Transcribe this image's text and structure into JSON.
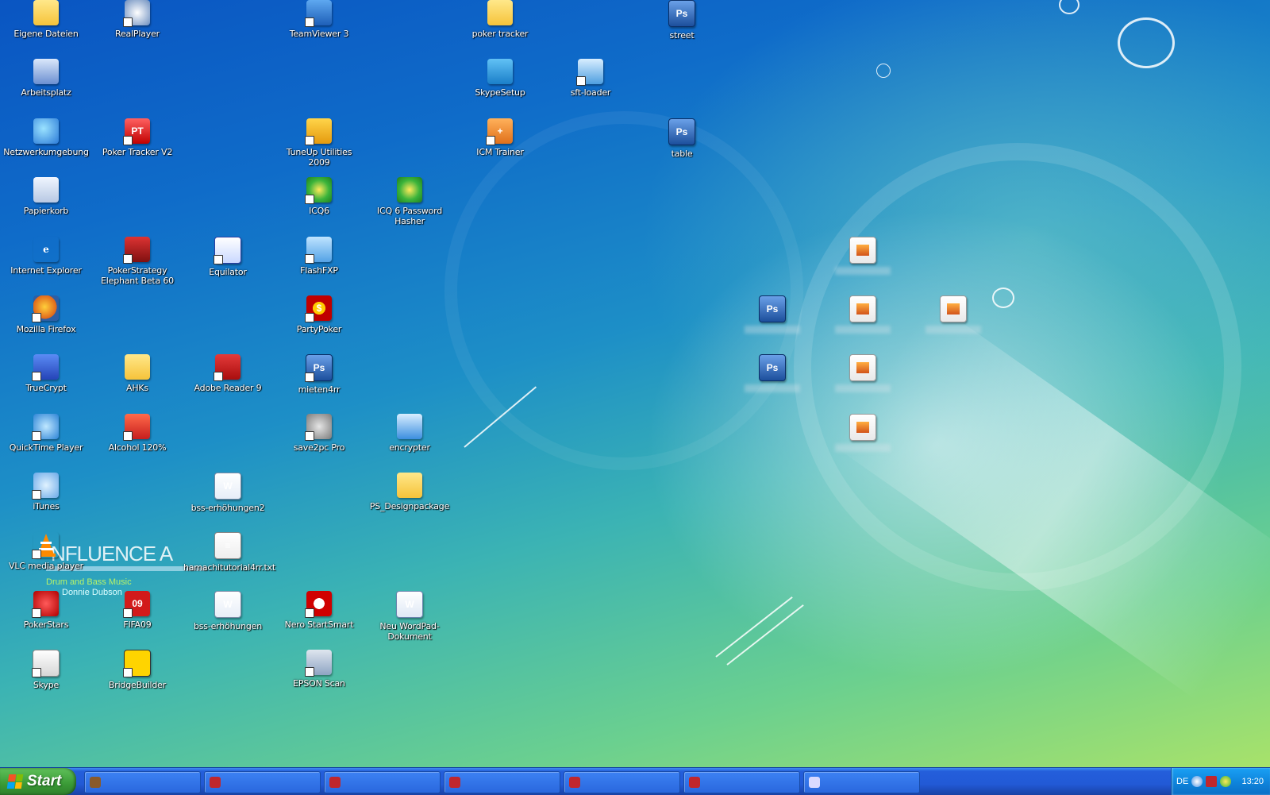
{
  "desktop": {
    "icons": [
      {
        "label": "Eigene Dateien",
        "icon": "folder-icon",
        "style": "g-folder",
        "shortcut": false
      },
      {
        "label": "Arbeitsplatz",
        "icon": "computer-icon",
        "style": "g-pc",
        "shortcut": false
      },
      {
        "label": "Netzwerkumgebung",
        "icon": "network-icon",
        "style": "g-net",
        "shortcut": false
      },
      {
        "label": "Papierkorb",
        "icon": "recycle-bin-icon",
        "style": "g-trash",
        "shortcut": false
      },
      {
        "label": "Internet Explorer",
        "icon": "internet-explorer-icon",
        "style": "g-ie",
        "glyph": "e",
        "shortcut": false
      },
      {
        "label": "Mozilla Firefox",
        "icon": "firefox-icon",
        "style": "g-ff",
        "shortcut": true
      },
      {
        "label": "TrueCrypt",
        "icon": "truecrypt-icon",
        "style": "g-tc",
        "shortcut": true
      },
      {
        "label": "QuickTime Player",
        "icon": "quicktime-icon",
        "style": "g-qt",
        "shortcut": true
      },
      {
        "label": "iTunes",
        "icon": "itunes-icon",
        "style": "g-it",
        "shortcut": true
      },
      {
        "label": "VLC media player",
        "icon": "vlc-cone-icon",
        "style": "g-vlc",
        "shortcut": true
      },
      {
        "label": "PokerStars",
        "icon": "pokerstars-icon",
        "style": "g-ps2",
        "shortcut": true
      },
      {
        "label": "Skype",
        "icon": "skype-icon",
        "style": "g-skype",
        "shortcut": true
      },
      {
        "label": "RealPlayer",
        "icon": "realplayer-icon",
        "style": "g-real",
        "shortcut": true
      },
      {
        "label": "Poker Tracker V2",
        "icon": "poker-tracker-icon",
        "style": "g-pt",
        "glyph": "PT",
        "shortcut": true
      },
      {
        "label": "PokerStrategy Elephant Beta 60",
        "icon": "elephant-icon",
        "style": "g-elephant",
        "shortcut": true
      },
      {
        "label": "AHKs",
        "icon": "folder-icon",
        "style": "g-ahk",
        "shortcut": false
      },
      {
        "label": "Alcohol 120%",
        "icon": "alcohol-icon",
        "style": "g-alc",
        "shortcut": true
      },
      {
        "label": "FIFA09",
        "icon": "fifa-icon",
        "style": "g-fifa",
        "glyph": "09",
        "shortcut": true
      },
      {
        "label": "BridgeBuilder",
        "icon": "bridgebuilder-icon",
        "style": "g-bridge",
        "shortcut": true
      },
      {
        "label": "Equilator",
        "icon": "equilator-icon",
        "style": "g-eq",
        "shortcut": true
      },
      {
        "label": "Adobe Reader 9",
        "icon": "adobe-reader-icon",
        "style": "g-pdf",
        "shortcut": true
      },
      {
        "label": "bss-erhöhungen2",
        "icon": "word-document-icon",
        "style": "g-doc",
        "glyph": "W",
        "shortcut": false
      },
      {
        "label": "hamachitutorial4rr.txt",
        "icon": "text-file-icon",
        "style": "g-txt",
        "glyph": "≡",
        "shortcut": false
      },
      {
        "label": "bss-erhöhungen",
        "icon": "word-document-icon",
        "style": "g-doc",
        "glyph": "W",
        "shortcut": false
      },
      {
        "label": "TeamViewer 3",
        "icon": "teamviewer-icon",
        "style": "g-tv",
        "shortcut": true
      },
      {
        "label": "TuneUp Utilities 2009",
        "icon": "tuneup-icon",
        "style": "g-tune",
        "shortcut": true
      },
      {
        "label": "ICQ6",
        "icon": "icq-flower-icon",
        "style": "g-icq",
        "shortcut": true
      },
      {
        "label": "FlashFXP",
        "icon": "flashfxp-icon",
        "style": "g-ftp",
        "shortcut": true
      },
      {
        "label": "PartyPoker",
        "icon": "partypoker-icon",
        "style": "g-party",
        "glyph": "$",
        "shortcut": true
      },
      {
        "label": "mieten4rr",
        "icon": "photoshop-file-icon",
        "style": "g-ps",
        "glyph": "Ps",
        "shortcut": true
      },
      {
        "label": "save2pc Pro",
        "icon": "save2pc-icon",
        "style": "g-save",
        "shortcut": true
      },
      {
        "label": "Nero StartSmart",
        "icon": "nero-icon",
        "style": "g-nero",
        "shortcut": true
      },
      {
        "label": "EPSON Scan",
        "icon": "scanner-icon",
        "style": "g-epson",
        "shortcut": true
      },
      {
        "label": "ICQ 6 Password Hasher",
        "icon": "icq-flower-icon",
        "style": "g-icq",
        "shortcut": false
      },
      {
        "label": "encrypter",
        "icon": "encrypter-icon",
        "style": "g-enc",
        "shortcut": false
      },
      {
        "label": "PS_Designpackage",
        "icon": "folder-icon",
        "style": "g-folder",
        "shortcut": false
      },
      {
        "label": "Neu WordPad-Dokument",
        "icon": "wordpad-document-icon",
        "style": "g-wp",
        "glyph": "W",
        "shortcut": false
      },
      {
        "label": "poker tracker",
        "icon": "folder-icon",
        "style": "g-folder",
        "shortcut": false
      },
      {
        "label": "SkypeSetup",
        "icon": "installer-icon",
        "style": "g-skypesetup",
        "shortcut": false
      },
      {
        "label": "ICM Trainer",
        "icon": "icm-trainer-icon",
        "style": "g-icm",
        "glyph": "+",
        "shortcut": true
      },
      {
        "label": "sft-loader",
        "icon": "loader-icon",
        "style": "g-sft",
        "shortcut": true
      },
      {
        "label": "street",
        "icon": "photoshop-file-icon",
        "style": "g-ps",
        "glyph": "Ps",
        "shortcut": false
      },
      {
        "label": "table",
        "icon": "photoshop-file-icon",
        "style": "g-ps",
        "glyph": "Ps",
        "shortcut": false
      },
      {
        "label": "",
        "icon": "photoshop-file-icon",
        "style": "g-ps",
        "glyph": "Ps",
        "shortcut": false
      },
      {
        "label": "",
        "icon": "photoshop-file-icon",
        "style": "g-ps",
        "glyph": "Ps",
        "shortcut": false
      },
      {
        "label": "",
        "icon": "image-file-icon",
        "style": "g-img",
        "shortcut": false
      },
      {
        "label": "",
        "icon": "image-file-icon",
        "style": "g-img",
        "shortcut": false
      },
      {
        "label": "",
        "icon": "image-file-icon",
        "style": "g-img",
        "shortcut": false
      },
      {
        "label": "",
        "icon": "image-file-icon",
        "style": "g-img",
        "shortcut": false
      },
      {
        "label": "",
        "icon": "image-file-icon",
        "style": "g-img",
        "shortcut": false
      }
    ],
    "wallpaper_text": {
      "influence": "NFLUENCE A",
      "music": "Drum and Bass Music",
      "artist": "Donnie Dubson"
    }
  },
  "taskbar": {
    "start_label": "Start",
    "tasks": [
      {
        "label": "",
        "icon_color": "#8a5a2b"
      },
      {
        "label": "",
        "icon_color": "#c0272d"
      },
      {
        "label": "",
        "icon_color": "#c0272d"
      },
      {
        "label": "",
        "icon_color": "#c0272d"
      },
      {
        "label": "",
        "icon_color": "#c0272d"
      },
      {
        "label": "",
        "icon_color": "#c0272d"
      },
      {
        "label": "",
        "icon_color": "#d9d9ff"
      }
    ],
    "tray": {
      "language": "DE",
      "clock": "13:20",
      "icons": [
        "network-tray-icon",
        "alcohol-tray-icon",
        "icq-tray-icon"
      ]
    }
  },
  "colors": {
    "taskbar_blue": "#245edb",
    "start_green": "#3a9a36",
    "tray_blue": "#0f86dd"
  }
}
